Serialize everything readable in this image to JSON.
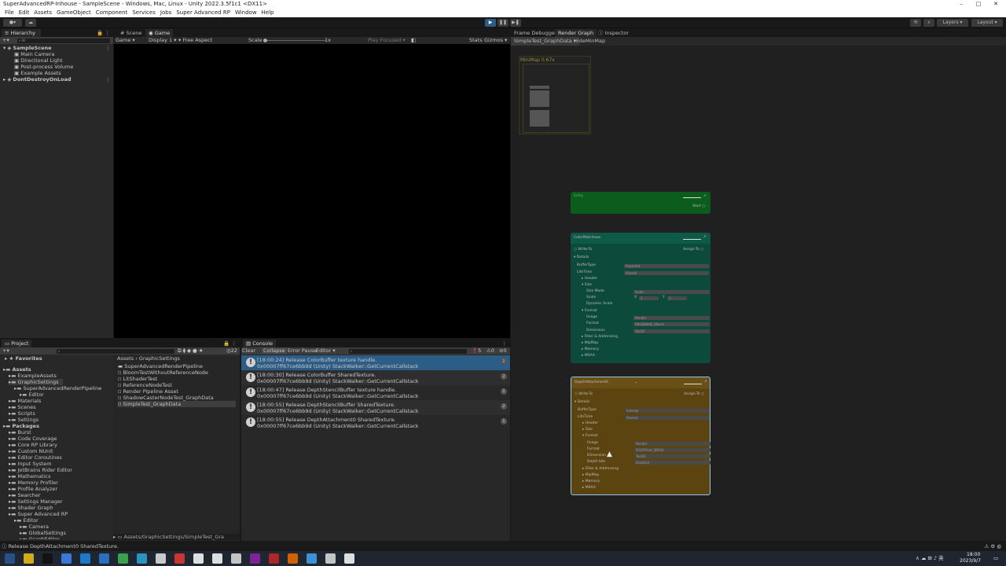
{
  "window": {
    "title": "SuperAdvancedRP-Inhouse - SampleScene - Windows, Mac, Linux - Unity 2022.3.5f1c1 <DX11>",
    "minimize": "–",
    "maximize": "□",
    "close": "✕"
  },
  "menu": [
    "File",
    "Edit",
    "Assets",
    "GameObject",
    "Component",
    "Services",
    "Jobs",
    "Super Advanced RP",
    "Window",
    "Help"
  ],
  "toolbar": {
    "layers": "Layers",
    "layout": "Layout",
    "play_icon": "▶",
    "pause_icon": "❚❚",
    "step_icon": "▶❚"
  },
  "hierarchy": {
    "tab": "Hierarchy",
    "search_placeholder": "All",
    "items": [
      {
        "label": "SampleScene",
        "indent": 0,
        "type": "scene"
      },
      {
        "label": "Main Camera",
        "indent": 1,
        "type": "go"
      },
      {
        "label": "Directional Light",
        "indent": 1,
        "type": "go"
      },
      {
        "label": "Post-process Volume",
        "indent": 1,
        "type": "go"
      },
      {
        "label": "Example Assets",
        "indent": 1,
        "type": "go"
      },
      {
        "label": "DontDestroyOnLoad",
        "indent": 0,
        "type": "scene"
      }
    ]
  },
  "scene_view": {
    "tabs": [
      "Scene",
      "Game"
    ],
    "active_tab": "Game",
    "game_dropdown": "Game",
    "display": "Display 1",
    "aspect": "Free Aspect",
    "scale_label": "Scale",
    "scale_value": "1x",
    "play_focused": "Play Focused",
    "stats": "Stats",
    "gizmos": "Gizmos"
  },
  "render_graph": {
    "tabs": [
      "Frame Debugger",
      "Render Graph",
      "Inspector"
    ],
    "active_tab": "Render Graph",
    "file_tab": "SimpleTest_GraphData",
    "hide_minimap": "HideMinMap",
    "minimap_label": "MiniMap",
    "minimap_zoom": "0.67x",
    "nodes": {
      "entry": {
        "title": "Entry",
        "port": "Start"
      },
      "color": {
        "title": "ColorMatchews",
        "write_label": "Write-To",
        "assign_label": "Assign-To",
        "details": "Details",
        "buffer_type_label": "BufferType",
        "buffer_type_value": "Imported",
        "life_time_label": "LifeTime",
        "life_time_value": "Shared",
        "rows": [
          "Header",
          "Size",
          "Size Mode",
          "Scale",
          "Dynamic Scale",
          "Format",
          "Usage",
          "Format",
          "Dimension",
          "Filter & Addressing",
          "MipMap",
          "Memory",
          "MSAA"
        ],
        "size_mode_value": "Scale",
        "scale_x": "X",
        "scale_x_value": "1",
        "scale_y": "Y",
        "scale_y_value": "1",
        "usage_value": "Render",
        "format_value": "R8G8B8A8_UNorm",
        "dimension_value": "Tex2D"
      },
      "depth": {
        "title": "DepthAttachment0",
        "write_label": "Write-To",
        "assign_label": "Assign-To",
        "details": "Details",
        "buffer_type_label": "BufferType",
        "buffer_type_value": "Internal",
        "life_time_label": "LifeTime",
        "life_time_value": "Shared",
        "rows": [
          "Header",
          "Size",
          "Format",
          "Usage",
          "Format",
          "Dimension",
          "Depth bits",
          "Filter & Addressing",
          "MipMap",
          "Memory",
          "MSAA"
        ],
        "usage_value": "Render",
        "format_value": "D32SFloat_S8Uint",
        "dimension_value": "Tex2D",
        "depth_bits_value": "Depth24"
      }
    }
  },
  "project": {
    "tab": "Project",
    "favorites": "Favorites",
    "tree": [
      {
        "label": "Assets",
        "indent": 0,
        "bold": true
      },
      {
        "label": "ExampleAssets",
        "indent": 1
      },
      {
        "label": "GraphicSettings",
        "indent": 1
      },
      {
        "label": "SuperAdvancedRenderPipeline",
        "indent": 2
      },
      {
        "label": "Editor",
        "indent": 3
      },
      {
        "label": "Materials",
        "indent": 1
      },
      {
        "label": "Scenes",
        "indent": 1
      },
      {
        "label": "Scripts",
        "indent": 1
      },
      {
        "label": "Settings",
        "indent": 1
      },
      {
        "label": "Packages",
        "indent": 0,
        "bold": true
      },
      {
        "label": "Burst",
        "indent": 1
      },
      {
        "label": "Code Coverage",
        "indent": 1
      },
      {
        "label": "Core RP Library",
        "indent": 1
      },
      {
        "label": "Custom NUnit",
        "indent": 1
      },
      {
        "label": "Editor Coroutines",
        "indent": 1
      },
      {
        "label": "Input System",
        "indent": 1
      },
      {
        "label": "JetBrains Rider Editor",
        "indent": 1
      },
      {
        "label": "Mathematics",
        "indent": 1
      },
      {
        "label": "Memory Profiler",
        "indent": 1
      },
      {
        "label": "Profile Analyzer",
        "indent": 1
      },
      {
        "label": "Searcher",
        "indent": 1
      },
      {
        "label": "Settings Manager",
        "indent": 1
      },
      {
        "label": "Shader Graph",
        "indent": 1
      },
      {
        "label": "Super Advanced RP",
        "indent": 1
      },
      {
        "label": "Editor",
        "indent": 2
      },
      {
        "label": "Camera",
        "indent": 3
      },
      {
        "label": "GlobalSettings",
        "indent": 3
      },
      {
        "label": "GraphEditor",
        "indent": 3
      }
    ],
    "breadcrumb_root": "Assets",
    "breadcrumb_sep": "›",
    "breadcrumb_leaf": "GraphicSettings",
    "assets": [
      "SuperAdvancedRenderPipeline",
      "BloomTestWithoutReferenceNode",
      "LitShaderTest",
      "ReferenceNodeTest",
      "Render Pipeline Asset",
      "ShadowCasterNodeTest_GraphData",
      "SimpleTest_GraphData"
    ],
    "selected_asset": "SimpleTest_GraphData",
    "path": "Assets/GraphicSettings/SimpleTest_Gra",
    "count": "22"
  },
  "console": {
    "tab": "Console",
    "buttons": [
      "Clear",
      "Collapse",
      "Error Pause",
      "Editor"
    ],
    "counts": {
      "info": "5",
      "warn": "0",
      "error": "0"
    },
    "entries": [
      {
        "line1": "[18:00:24] Release ColorBuffer texture handle.",
        "line2": "0x00007ff67ce6bb9d (Unity) StackWalker::GetCurrentCallstack",
        "count": "1",
        "selected": true
      },
      {
        "line1": "[18:00:30] Release ColorBuffer SharedTexture.",
        "line2": "0x00007ff67ce6bb9d (Unity) StackWalker::GetCurrentCallstack",
        "count": "2",
        "selected": false
      },
      {
        "line1": "[18:00:47] Release DepthStencilBuffer texture handle.",
        "line2": "0x00007ff67ce6bb9d (Unity) StackWalker::GetCurrentCallstack",
        "count": "1",
        "selected": false
      },
      {
        "line1": "[18:00:55] Release DepthStencilBuffer SharedTexture.",
        "line2": "0x00007ff67ce6bb9d (Unity) StackWalker::GetCurrentCallstack",
        "count": "2",
        "selected": false
      },
      {
        "line1": "[18:00:55] Release DepthAttachment0 SharedTexture.",
        "line2": "0x00007ff67ce6bb9d (Unity) StackWalker::GetCurrentCallstack",
        "count": "1",
        "selected": false
      }
    ]
  },
  "statusbar": {
    "message": "Release DepthAttachment0 SharedTexture."
  },
  "taskbar": {
    "time": "18:00",
    "date": "2023/9/7",
    "lang": "英",
    "app_colors": [
      "#2b5797",
      "#f0c419",
      "#111111",
      "#4285f4",
      "#1e88e5",
      "#2d7bd6",
      "#3fb950",
      "#2fa6d9",
      "#e6e6e6",
      "#e53935",
      "#ffffff",
      "#ffffff",
      "#e0e0e0",
      "#8e24aa",
      "#c62828",
      "#ef6c00",
      "#42a5f5",
      "#e0e0e0",
      "#ffffff"
    ]
  },
  "colors": {
    "node_entry": "#0c5c1e",
    "node_color": "#0c4a3b",
    "node_depth": "#5c4410",
    "accent_blue": "#2c5d87"
  }
}
